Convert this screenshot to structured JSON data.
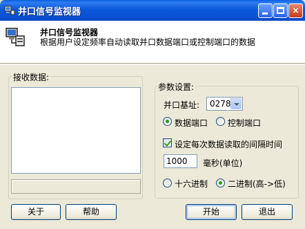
{
  "window": {
    "title": "并口信号监视器",
    "controls": {
      "minimize": "minimize",
      "maximize": "maximize",
      "close": "×"
    }
  },
  "header": {
    "title": "并口信号监视器",
    "description": "根据用户设定频率自动读取并口数据端口或控制端口的数据"
  },
  "receive": {
    "label": "接收数据:"
  },
  "settings": {
    "group_label": "参数设置:",
    "base_address_label": "并口基址:",
    "base_address_value": "0278",
    "port_options": [
      {
        "label": "数据端口",
        "selected": true
      },
      {
        "label": "控制端口",
        "selected": false
      }
    ],
    "interval_checkbox_label": "设定每次数据读取的间隔时间",
    "interval_checked": true,
    "interval_value": "1000",
    "interval_unit": "毫秒(单位)",
    "format_options": [
      {
        "label": "十六进制",
        "selected": false
      },
      {
        "label": "二进制(高->低)",
        "selected": true
      }
    ]
  },
  "buttons": {
    "about": "关于",
    "help": "帮助",
    "start": "开始",
    "exit": "退出"
  },
  "colors": {
    "titlebar": "#0a54d6",
    "window_bg": "#ece9d8",
    "radio_dot": "#21a121"
  }
}
